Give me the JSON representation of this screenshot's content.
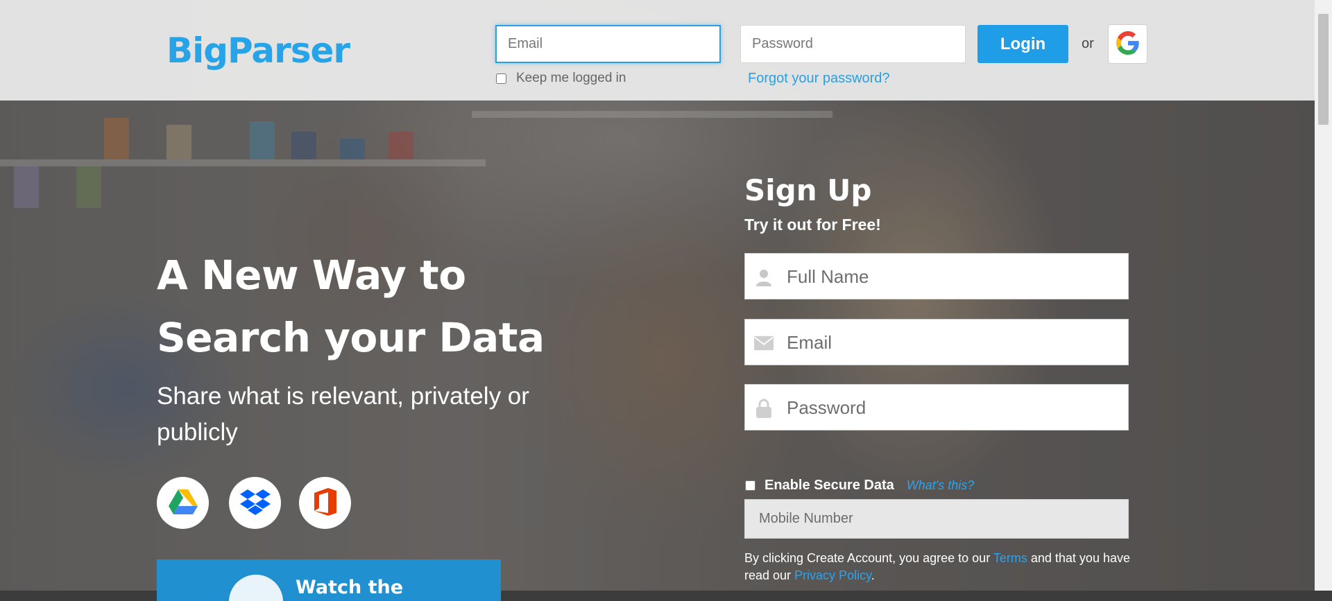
{
  "header": {
    "logo": "BigParser",
    "email_placeholder": "Email",
    "password_placeholder": "Password",
    "login_label": "Login",
    "or_label": "or",
    "google_icon": "google-logo-icon",
    "keep_logged_label": "Keep me logged in",
    "forgot_label": "Forgot your password?"
  },
  "hero": {
    "title_line1": "A New Way to",
    "title_line2": "Search your Data",
    "subtitle": "Share what is relevant, privately or publicly",
    "services": [
      {
        "name": "google-drive-icon"
      },
      {
        "name": "dropbox-icon"
      },
      {
        "name": "office-icon"
      }
    ],
    "watch_label": "Watch the"
  },
  "signup": {
    "title": "Sign Up",
    "subtitle": "Try it out for Free!",
    "fullname_placeholder": "Full Name",
    "email_placeholder": "Email",
    "password_placeholder": "Password",
    "secure_label": "Enable Secure Data",
    "whats_this": "What's this?",
    "mobile_placeholder": "Mobile Number",
    "terms_prefix": "By clicking Create Account, you agree to our ",
    "terms_link": "Terms",
    "terms_middle": " and that you have read our ",
    "privacy_link": "Privacy Policy",
    "terms_suffix": "."
  },
  "colors": {
    "brand_blue": "#27a3e7",
    "login_button": "#1f9de6",
    "link": "#2a9fe0"
  }
}
